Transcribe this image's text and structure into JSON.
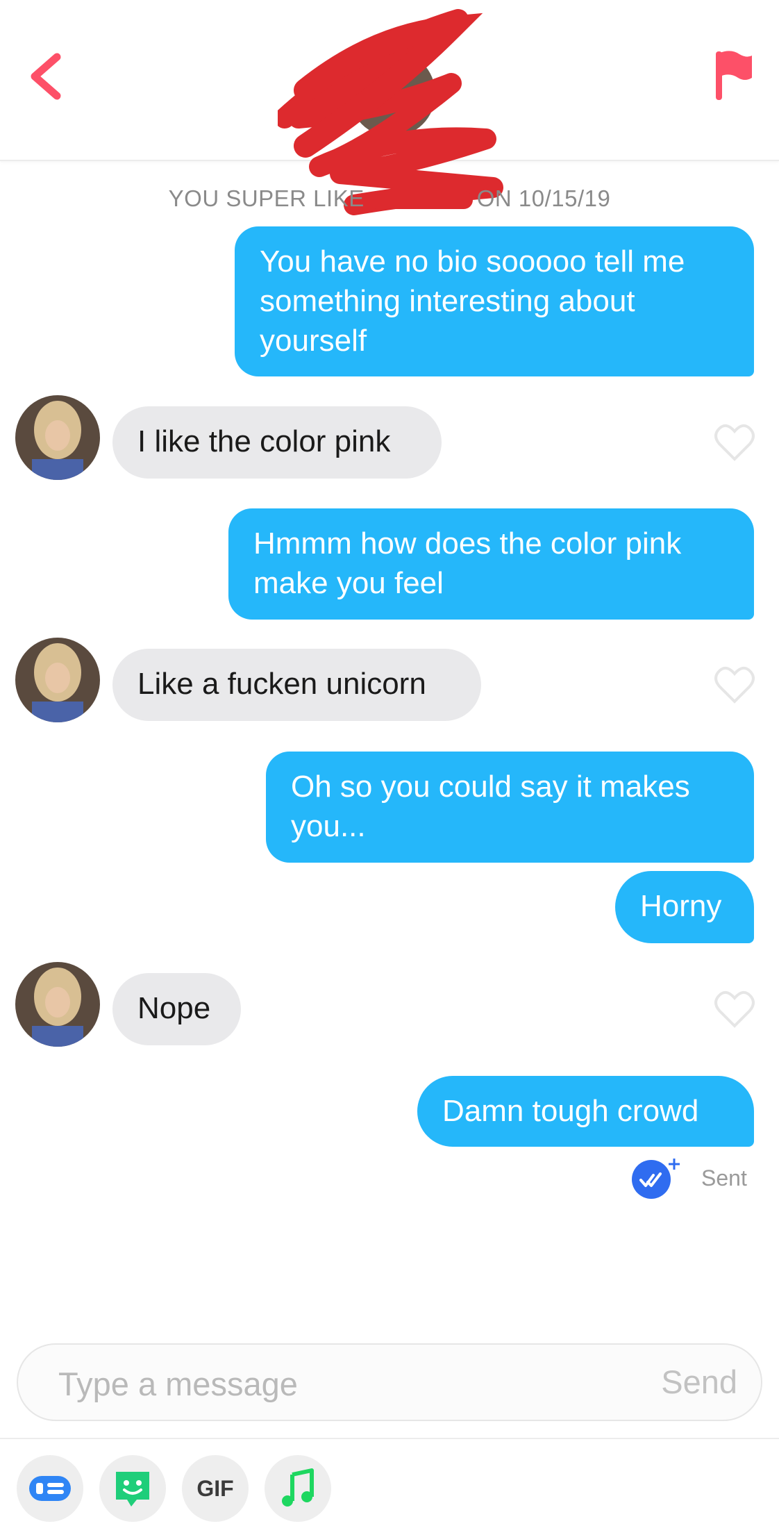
{
  "header": {
    "back_icon": "chevron-left-icon",
    "flag_icon": "flag-icon",
    "accent_color": "#fd5068"
  },
  "meta": {
    "prefix": "YOU SUPER LIKE",
    "suffix": "ON 10/15/19"
  },
  "messages": [
    {
      "direction": "out",
      "text_lines": [
        "You have no bio sooooo tell me",
        "something interesting about",
        "yourself"
      ]
    },
    {
      "direction": "in",
      "text": "I like the color pink"
    },
    {
      "direction": "out",
      "text_lines": [
        "Hmmm how does the color pink",
        "make you feel"
      ]
    },
    {
      "direction": "in",
      "text": "Like a fucken unicorn"
    },
    {
      "direction": "out",
      "text_lines": [
        "Oh so you could say it makes",
        "you..."
      ]
    },
    {
      "direction": "out",
      "text": "Horny"
    },
    {
      "direction": "in",
      "text": "Nope"
    },
    {
      "direction": "out",
      "text": "Damn tough crowd"
    }
  ],
  "status": {
    "sent_label": "Sent",
    "sent_icon": "double-check-icon"
  },
  "composer": {
    "placeholder": "Type a message",
    "send_label": "Send"
  },
  "toolbar": {
    "gif_label": "GIF",
    "items": [
      "chat-card-icon",
      "sticker-icon",
      "gif-icon",
      "music-note-icon"
    ]
  },
  "colors": {
    "outgoing": "#25b7fa",
    "incoming": "#e9e9eb",
    "sent_badge": "#2f6cf0",
    "music": "#1ed760",
    "sticker": "#1fce7a"
  }
}
